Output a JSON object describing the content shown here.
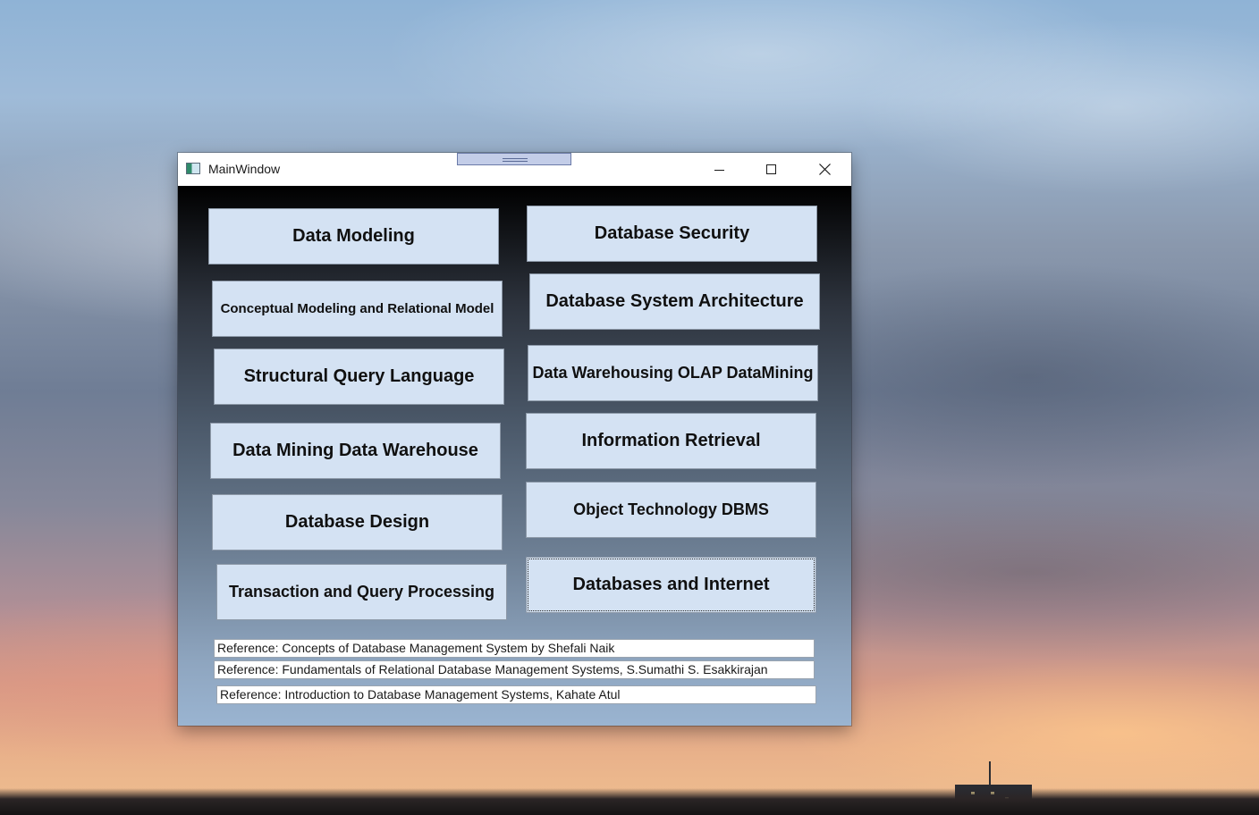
{
  "window": {
    "title": "MainWindow"
  },
  "topics": {
    "left": [
      "Data Modeling",
      "Conceptual Modeling and Relational Model",
      "Structural Query Language",
      "Data Mining Data Warehouse",
      "Database Design",
      "Transaction and Query Processing"
    ],
    "right": [
      "Database Security",
      "Database System Architecture",
      "Data Warehousing OLAP DataMining",
      "Information Retrieval",
      "Object Technology DBMS",
      "Databases and Internet"
    ]
  },
  "references": [
    "Reference: Concepts of Database Management System by Shefali Naik",
    "Reference: Fundamentals of Relational Database Management Systems, S.Sumathi S. Esakkirajan",
    "Reference: Introduction to Database Management Systems, Kahate Atul"
  ],
  "icons": {
    "app": "window-app-icon",
    "minimize": "minimize-icon",
    "maximize": "maximize-icon",
    "close": "close-icon"
  },
  "colors": {
    "button_background": "#d4e2f3",
    "client_gradient_top": "#000000",
    "client_gradient_bottom": "#9ab4d1"
  }
}
